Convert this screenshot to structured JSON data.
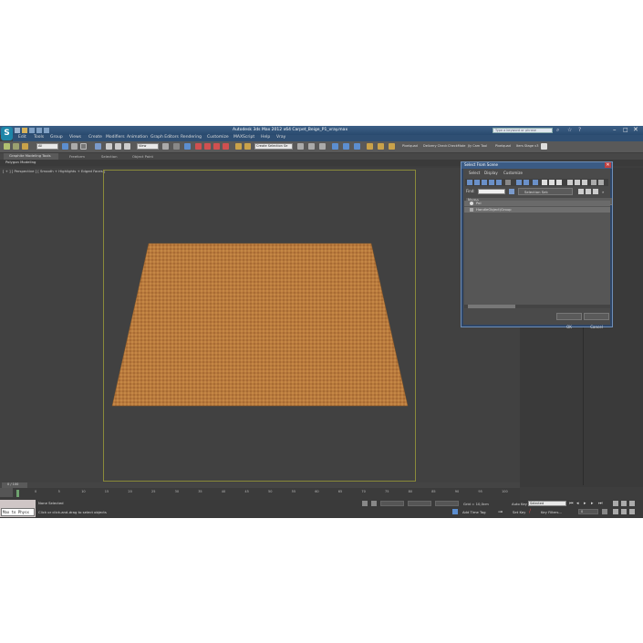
{
  "title": "Autodesk 3ds Max 2012 x64    Carpet_Beige_P1_vray.max",
  "search_placeholder": "Type a keyword or phrase",
  "menu": [
    "Edit",
    "Tools",
    "Group",
    "Views",
    "Create",
    "Modifiers",
    "Animation",
    "Graph Editors",
    "Rendering",
    "Customize",
    "MAXScript",
    "Help",
    "Vray"
  ],
  "toolbar": {
    "filter_value": "All",
    "view_value": "View",
    "selection_set": "Create Selection Se",
    "plugins": [
      "Pixelquad",
      "Delivery Check",
      "CheckMate",
      "Jly Cam Tool",
      "Pixelquad",
      "Iters Stage v3"
    ]
  },
  "ribbon": {
    "tabs": [
      "Graphite Modeling Tools",
      "Freeform",
      "Selection",
      "Object Paint"
    ],
    "subtitle": "Polygon Modeling"
  },
  "viewport": {
    "label": "[ + ] [ Perspective ] [ Smooth + Highlights + Edged Faces ]"
  },
  "dialog": {
    "title": "Select From Scene",
    "menu": [
      "Select",
      "Display",
      "Customize"
    ],
    "find_label": "Find:",
    "selection_set": "Selection Set:",
    "column_name": "Name",
    "items": [
      "Pol",
      "HandleObject\\Group"
    ],
    "ok": "OK",
    "cancel": "Cancel"
  },
  "timeline": {
    "frame_counter": "0 / 100",
    "ticks": [
      "0",
      "5",
      "10",
      "15",
      "20",
      "25",
      "30",
      "35",
      "40",
      "45",
      "50",
      "55",
      "60",
      "65",
      "70",
      "75",
      "80",
      "85",
      "90",
      "95",
      "100"
    ]
  },
  "status": {
    "maxscript_text": "Max to Physx",
    "selection": "None Selected",
    "prompt": "Click or click-and-drag to select objects",
    "grid": "Grid = 10,0cm",
    "add_time_tag": "Add Time Tag",
    "autokey": "Auto Key",
    "autokey_value": "Selected",
    "setkey": "Set Key",
    "key_filters": "Key Filters...",
    "frame": "0"
  },
  "colors": {
    "background": "#3d3d3d",
    "carpet": "#b97a3e",
    "title_bar": "#2f4f73",
    "dialog_border": "#6f8fb8"
  }
}
